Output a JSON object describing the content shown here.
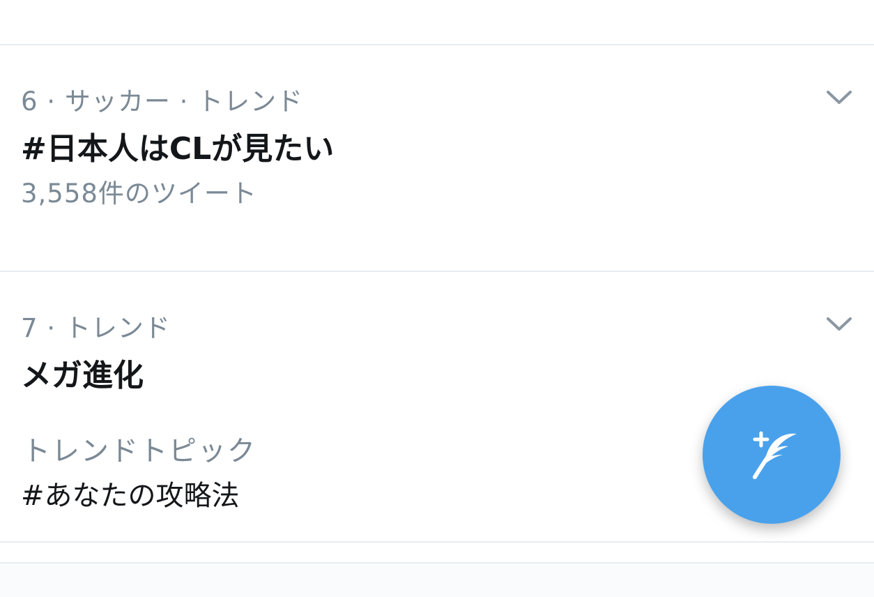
{
  "trends": [
    {
      "meta": "6 · サッカー · トレンド",
      "title": "#日本人はCLが見たい",
      "count": "3,558件のツイート",
      "menu_icon": "chevron-down-icon"
    },
    {
      "meta": "7 · トレンド",
      "title": "メガ進化",
      "topic_label": "トレンドトピック",
      "topic_value": "#あなたの攻略法",
      "menu_icon": "chevron-down-icon"
    }
  ],
  "compose_button": {
    "icon": "compose-tweet-icon"
  },
  "colors": {
    "accent": "#4aa1eb",
    "secondary_text": "#7b8995",
    "primary_text": "#14171a",
    "divider": "#e6ecf0"
  }
}
